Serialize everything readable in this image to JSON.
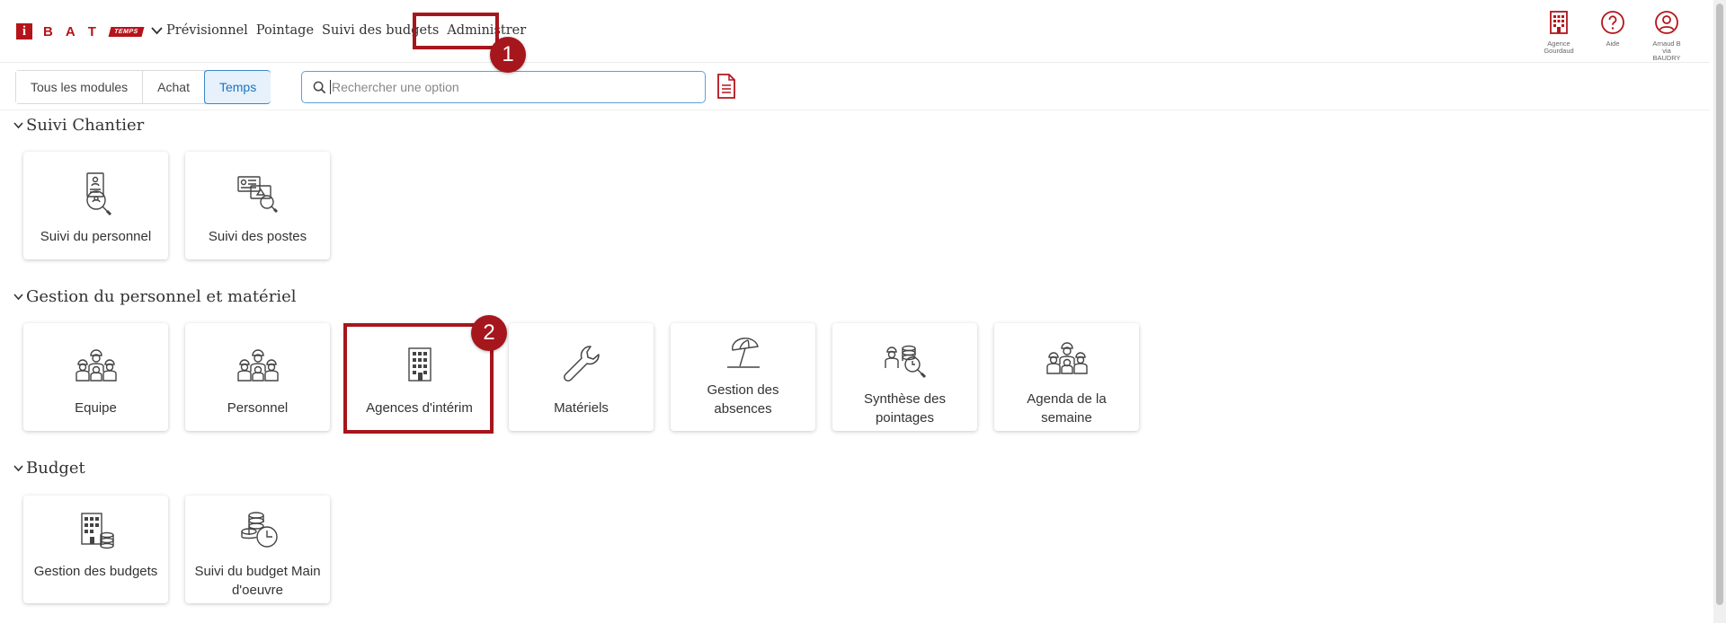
{
  "header": {
    "logo": {
      "i": "i",
      "letters": [
        "B",
        "A",
        "T"
      ],
      "product": "TEMPS"
    },
    "nav": [
      "Prévisionnel",
      "Pointage",
      "Suivi des budgets",
      "Administrer"
    ],
    "right": [
      {
        "icon": "building-icon",
        "label_lines": [
          "Agence",
          "Gourdaud"
        ]
      },
      {
        "icon": "help-circle-icon",
        "label_lines": [
          "Aide"
        ]
      },
      {
        "icon": "user-circle-icon",
        "label_lines": [
          "Arnaud B",
          "via BAUDRY"
        ]
      }
    ]
  },
  "toolbar": {
    "filters": [
      "Tous les modules",
      "Achat",
      "Temps"
    ],
    "active_filter": "Temps",
    "search_placeholder": "Rechercher une option"
  },
  "sections": [
    {
      "title": "Suivi Chantier",
      "tiles": [
        {
          "label": "Suivi du personnel",
          "icon": "personnel-search-icon"
        },
        {
          "label": "Suivi des postes",
          "icon": "postes-search-icon"
        }
      ]
    },
    {
      "title": "Gestion du personnel et matériel",
      "tiles": [
        {
          "label": "Equipe",
          "icon": "workers-group-icon"
        },
        {
          "label": "Personnel",
          "icon": "workers-group-icon"
        },
        {
          "label": "Agences d'intérim",
          "icon": "building-icon"
        },
        {
          "label": "Matériels",
          "icon": "wrench-icon"
        },
        {
          "label": "Gestion des absences",
          "icon": "beach-umbrella-icon"
        },
        {
          "label": "Synthèse des pointages",
          "icon": "coins-search-icon"
        },
        {
          "label": "Agenda de la semaine",
          "icon": "workers-group-icon"
        }
      ]
    },
    {
      "title": "Budget",
      "tiles": [
        {
          "label": "Gestion des budgets",
          "icon": "building-coins-icon"
        },
        {
          "label": "Suivi du budget Main d'oeuvre",
          "icon": "coins-clock-icon"
        }
      ]
    }
  ],
  "annotations": [
    "1",
    "2"
  ],
  "colors": {
    "brand": "#b5141b",
    "highlight": "#a6161d",
    "active_blue": "#3a87c9"
  }
}
